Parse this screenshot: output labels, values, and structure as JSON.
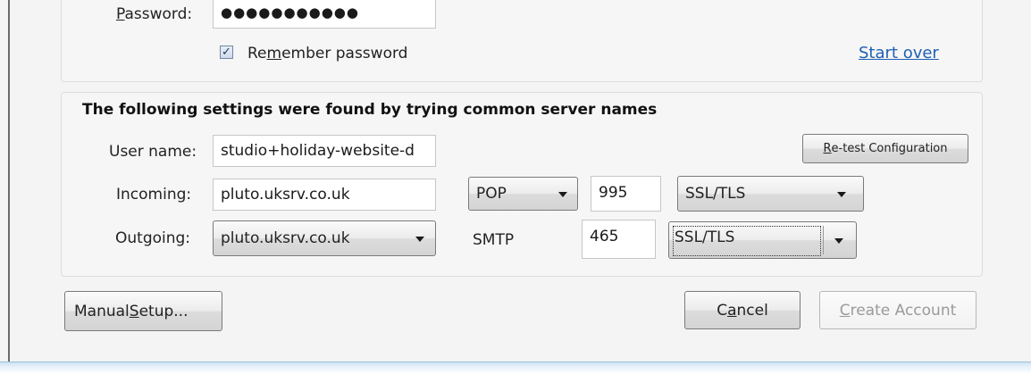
{
  "credentials": {
    "password_label_pre": "",
    "password_label_key": "P",
    "password_label_post": "assword:",
    "password_value": "●●●●●●●●●●●",
    "remember_checked": "✓",
    "remember_pre": "Re",
    "remember_key": "m",
    "remember_post": "ember password",
    "start_over": "Start over"
  },
  "settings": {
    "heading": "The following settings were found by trying common server names",
    "username_label": "User name:",
    "username_value": "studio+holiday-website-d",
    "retest_pre": "",
    "retest_key": "R",
    "retest_post": "e-test Configuration",
    "incoming_label": "Incoming:",
    "incoming_server": "pluto.uksrv.co.uk",
    "incoming_protocol": "POP",
    "incoming_port": "995",
    "incoming_security": "SSL/TLS",
    "outgoing_label": "Outgoing:",
    "outgoing_server": "pluto.uksrv.co.uk",
    "outgoing_protocol": "SMTP",
    "outgoing_port": "465",
    "outgoing_security": "SSL/TLS"
  },
  "footer": {
    "manual_pre": "Manual ",
    "manual_key": "S",
    "manual_post": "etup...",
    "cancel_pre": "C",
    "cancel_key": "a",
    "cancel_post": "ncel",
    "create_pre": "",
    "create_key": "C",
    "create_post": "reate Account"
  },
  "colors": {
    "link": "#1f5fb4",
    "checkbox_mark": "#203a66",
    "disabled_text": "#9a9a9a"
  }
}
